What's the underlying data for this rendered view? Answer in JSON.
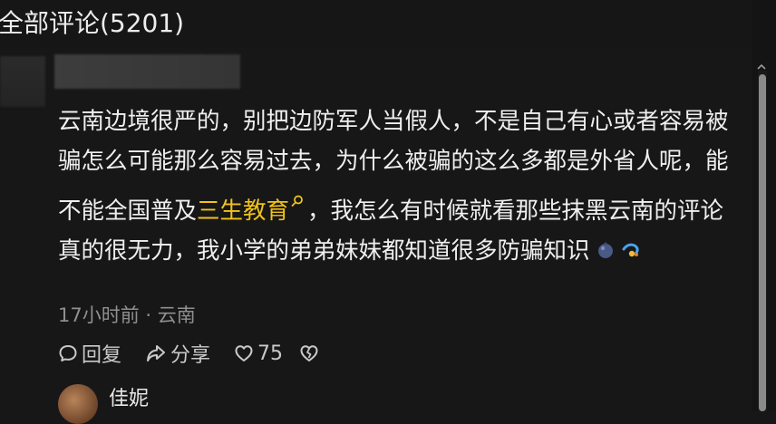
{
  "header": {
    "title": "全部评论(5201)"
  },
  "comment": {
    "text_before": "云南边境很严的，别把边防军人当假人，不是自己有心或者容易被骗怎么可能那么容易过去，为什么被骗的这么多都是外省人呢，能不能全国普及",
    "highlight": "三生教育",
    "text_after": "，我怎么有时候就看那些抹黑云南的评论真的很无力，我小学的弟弟妹妹都知道很多防骗知识",
    "emojis": [
      "blueberry-emoji",
      "blue-swirl-emoji"
    ],
    "meta": "17小时前 · 云南"
  },
  "actions": {
    "reply_label": "回复",
    "share_label": "分享",
    "like_count": "75"
  },
  "next_comment": {
    "author": "佳妮"
  },
  "colors": {
    "highlight": "#f1c21b",
    "background": "#171717"
  }
}
